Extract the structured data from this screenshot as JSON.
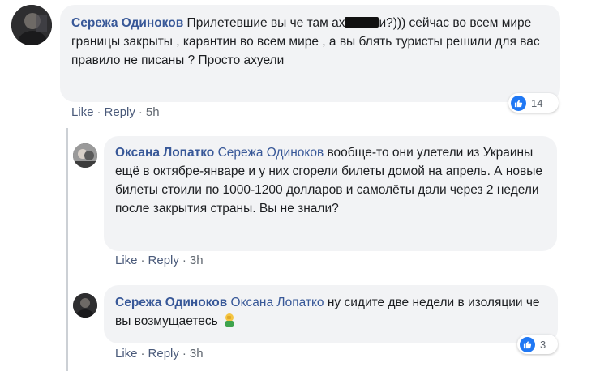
{
  "comments": [
    {
      "author": "Сережа Одиноков",
      "text_before": "Прилетевшие вы че там ах",
      "text_after": "и?))) сейчас во всем мире границы закрыты , карантин во всем мире , а вы блять туристы решили для вас правило не писаны ? Просто ахуели",
      "actions": {
        "like": "Like",
        "reply": "Reply",
        "time": "5h"
      },
      "reaction_count": "14"
    },
    {
      "author": "Оксана Лопатко",
      "mention": "Сережа Одиноков",
      "text": "вообще-то они улетели из Украины ещё в октябре-январе и у них сгорели билеты домой на апрель. А новые билеты стоили по 1000-1200 долларов и самолёты дали через 2 недели после закрытия страны. Вы не знали?",
      "actions": {
        "like": "Like",
        "reply": "Reply",
        "time": "3h"
      }
    },
    {
      "author": "Сережа Одиноков",
      "mention": "Оксана Лопатко",
      "text": "ну сидите две недели в изоляции че вы возмущаетесь",
      "emoji": "🤦",
      "actions": {
        "like": "Like",
        "reply": "Reply",
        "time": "3h"
      },
      "reaction_count": "3"
    }
  ],
  "icons": {
    "like_reaction": "thumbs-up-icon",
    "emoji": "facepalm-emoji"
  },
  "colors": {
    "author": "#385898",
    "bubble": "#f2f3f5",
    "like_blue": "#2078f4"
  }
}
